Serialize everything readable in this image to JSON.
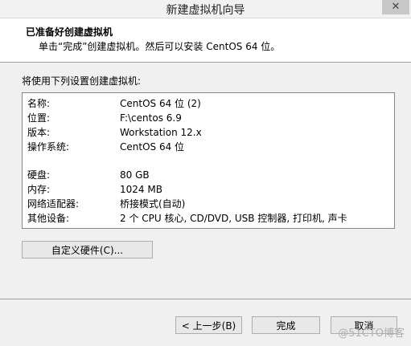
{
  "window": {
    "title": "新建虚拟机向导",
    "close_glyph": "✕"
  },
  "header": {
    "title": "已准备好创建虚拟机",
    "subtitle": "单击“完成”创建虚拟机。然后可以安装 CentOS 64 位。"
  },
  "intro": "将使用下列设置创建虚拟机:",
  "settings": [
    {
      "label": "名称:",
      "value": "CentOS 64 位 (2)"
    },
    {
      "label": "位置:",
      "value": "F:\\centos 6.9"
    },
    {
      "label": "版本:",
      "value": "Workstation 12.x"
    },
    {
      "label": "操作系统:",
      "value": "CentOS 64 位"
    },
    {
      "label": "硬盘:",
      "value": "80 GB"
    },
    {
      "label": "内存:",
      "value": "1024 MB"
    },
    {
      "label": "网络适配器:",
      "value": "桥接模式(自动)"
    },
    {
      "label": "其他设备:",
      "value": "2 个 CPU 核心, CD/DVD, USB 控制器, 打印机, 声卡"
    }
  ],
  "buttons": {
    "customize": "自定义硬件(C)...",
    "back": "< 上一步(B)",
    "finish": "完成",
    "cancel": "取消"
  },
  "watermark": "@51CTO博客"
}
